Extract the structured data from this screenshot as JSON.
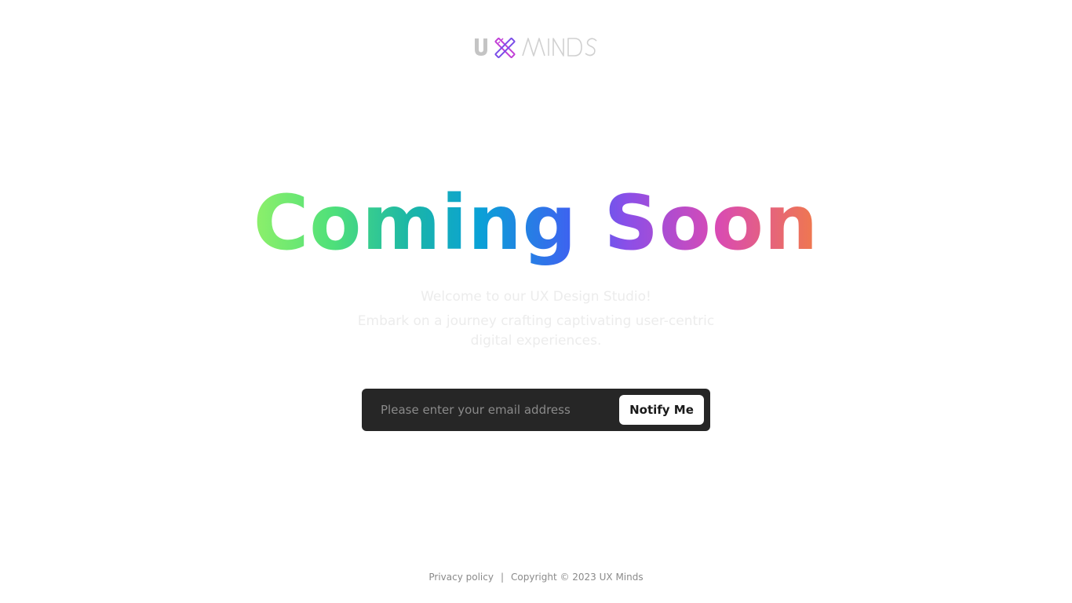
{
  "logo": {
    "text": "UX MINDS",
    "icon": "pencil-ruler-cross-icon",
    "colors": {
      "u": "#c4c4c4",
      "x_primary": "#c13fd6",
      "x_secondary": "#7a4de8",
      "minds": "#d0d0d0"
    }
  },
  "hero": {
    "headline": "Coming Soon",
    "gradient": [
      "#8ef06a",
      "#1ab5a8",
      "#0aa1d6",
      "#3d63f0",
      "#8a4fe8",
      "#d94ab4",
      "#f07a4a"
    ],
    "welcome": "Welcome to our UX Design Studio!",
    "description_line1": "Embark on a journey crafting captivating user-centric",
    "description_line2": "digital experiences."
  },
  "form": {
    "email_placeholder": "Please enter your email address",
    "email_value": "",
    "submit_label": "Notify Me"
  },
  "footer": {
    "privacy_label": "Privacy policy",
    "separator": "|",
    "copyright": "Copyright © 2023 UX Minds"
  }
}
